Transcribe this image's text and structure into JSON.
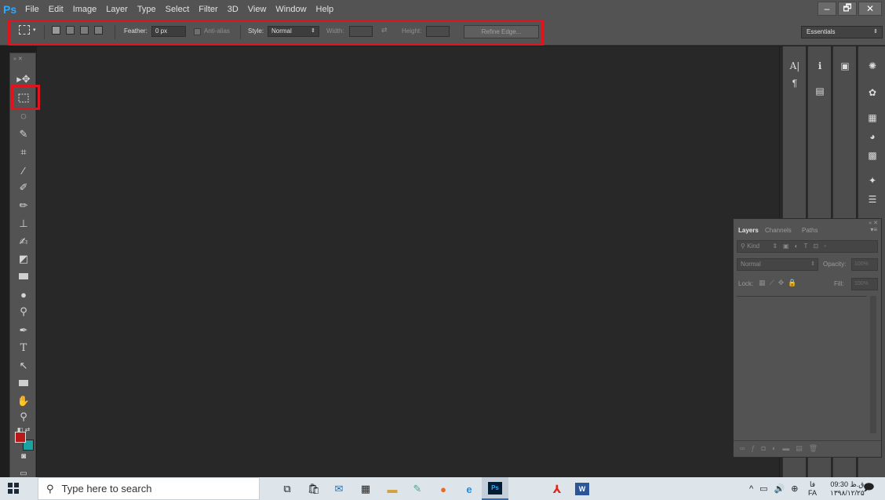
{
  "app": {
    "logo": "Ps"
  },
  "menu": [
    "File",
    "Edit",
    "Image",
    "Layer",
    "Type",
    "Select",
    "Filter",
    "3D",
    "View",
    "Window",
    "Help"
  ],
  "window_controls": {
    "minimize": "‒",
    "restore": "🗗",
    "close": "✕"
  },
  "options": {
    "feather_label": "Feather:",
    "feather_value": "0 px",
    "antialias_label": "Anti-alias",
    "style_label": "Style:",
    "style_value": "Normal",
    "width_label": "Width:",
    "height_label": "Height:",
    "refine_label": "Refine Edge...",
    "workspace": "Essentials"
  },
  "layers_panel": {
    "tabs": [
      "Layers",
      "Channels",
      "Paths"
    ],
    "kind_label": "Kind",
    "blend_mode": "Normal",
    "opacity_label": "Opacity:",
    "opacity_value": "100%",
    "lock_label": "Lock:",
    "fill_label": "Fill:",
    "fill_value": "100%"
  },
  "dock": {
    "character_glyph": "A|",
    "paragraph_glyph": "¶"
  },
  "taskbar": {
    "search_placeholder": "Type here to search",
    "time": "09:30 ق.ظ",
    "date": "۱۳۹۸/۱۲/۲۵",
    "lang_fa": "فا",
    "lang_code": "FA",
    "ps_label": "Ps",
    "word_label": "W"
  },
  "colors": {
    "foreground_swatch": "#b81a1a",
    "background_swatch": "#19a3a3",
    "highlight": "#e0141e"
  }
}
